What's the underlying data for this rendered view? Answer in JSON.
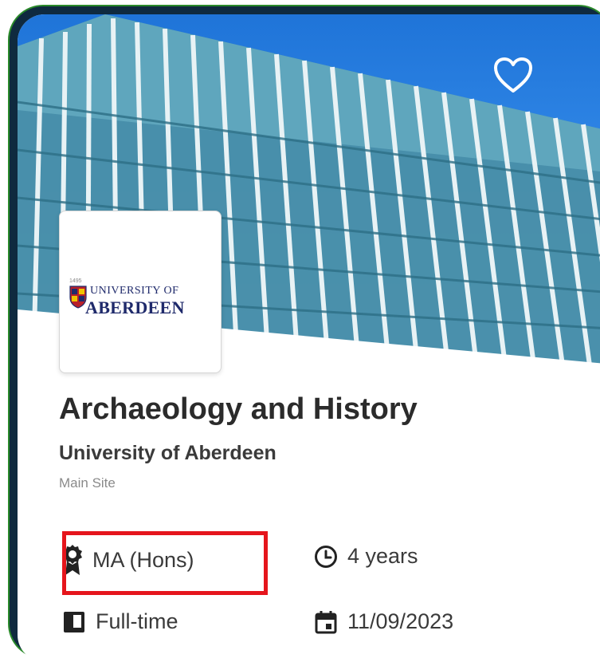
{
  "course": {
    "title": "Archaeology and History",
    "university": "University of Aberdeen",
    "campus": "Main Site"
  },
  "logo": {
    "year": "1495",
    "line1": "UNIVERSITY OF",
    "line2": "ABERDEEN"
  },
  "details": {
    "qualification": "MA (Hons)",
    "duration": "4 years",
    "study_mode": "Full-time",
    "start_date": "11/09/2023"
  },
  "icons": {
    "favorite": "heart-icon",
    "qualification": "award-ribbon-icon",
    "duration": "clock-icon",
    "study_mode": "book-icon",
    "start_date": "calendar-icon"
  },
  "colors": {
    "highlight": "#e5151c",
    "frame": "#2a8a2a",
    "brand": "#1f2a6b"
  }
}
